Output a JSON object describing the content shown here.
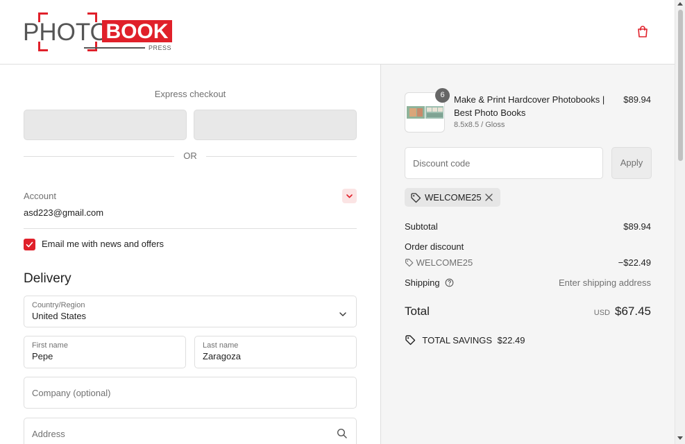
{
  "brand": {
    "logo_word_1": "PHOTO",
    "logo_word_2": "BOOK",
    "logo_sub": "PRESS",
    "accent": "#e0202a"
  },
  "header": {
    "cart_icon": "shopping-bag-icon"
  },
  "express": {
    "title": "Express checkout",
    "divider_text": "OR"
  },
  "account": {
    "label": "Account",
    "email": "asd223@gmail.com",
    "chevron_icon": "chevron-down-icon",
    "newsletter_label": "Email me with news and offers",
    "newsletter_checked": true
  },
  "delivery": {
    "title": "Delivery",
    "country_label": "Country/Region",
    "country_value": "United States",
    "first_name_label": "First name",
    "first_name_value": "Pepe",
    "last_name_label": "Last name",
    "last_name_value": "Zaragoza",
    "company_placeholder": "Company (optional)",
    "address_placeholder": "Address"
  },
  "summary": {
    "product": {
      "quantity": "6",
      "name": "Make & Print Hardcover Photobooks | Best Photo Books",
      "variant": "8.5x8.5 / Gloss",
      "price": "$89.94"
    },
    "discount_placeholder": "Discount code",
    "apply_label": "Apply",
    "applied_code": "WELCOME25",
    "subtotal_label": "Subtotal",
    "subtotal_value": "$89.94",
    "order_discount_label": "Order discount",
    "order_discount_code": "WELCOME25",
    "order_discount_value": "−$22.49",
    "shipping_label": "Shipping",
    "shipping_value": "Enter shipping address",
    "total_label": "Total",
    "total_currency": "USD",
    "total_value": "$67.45",
    "savings_label": "TOTAL SAVINGS",
    "savings_value": "$22.49"
  }
}
